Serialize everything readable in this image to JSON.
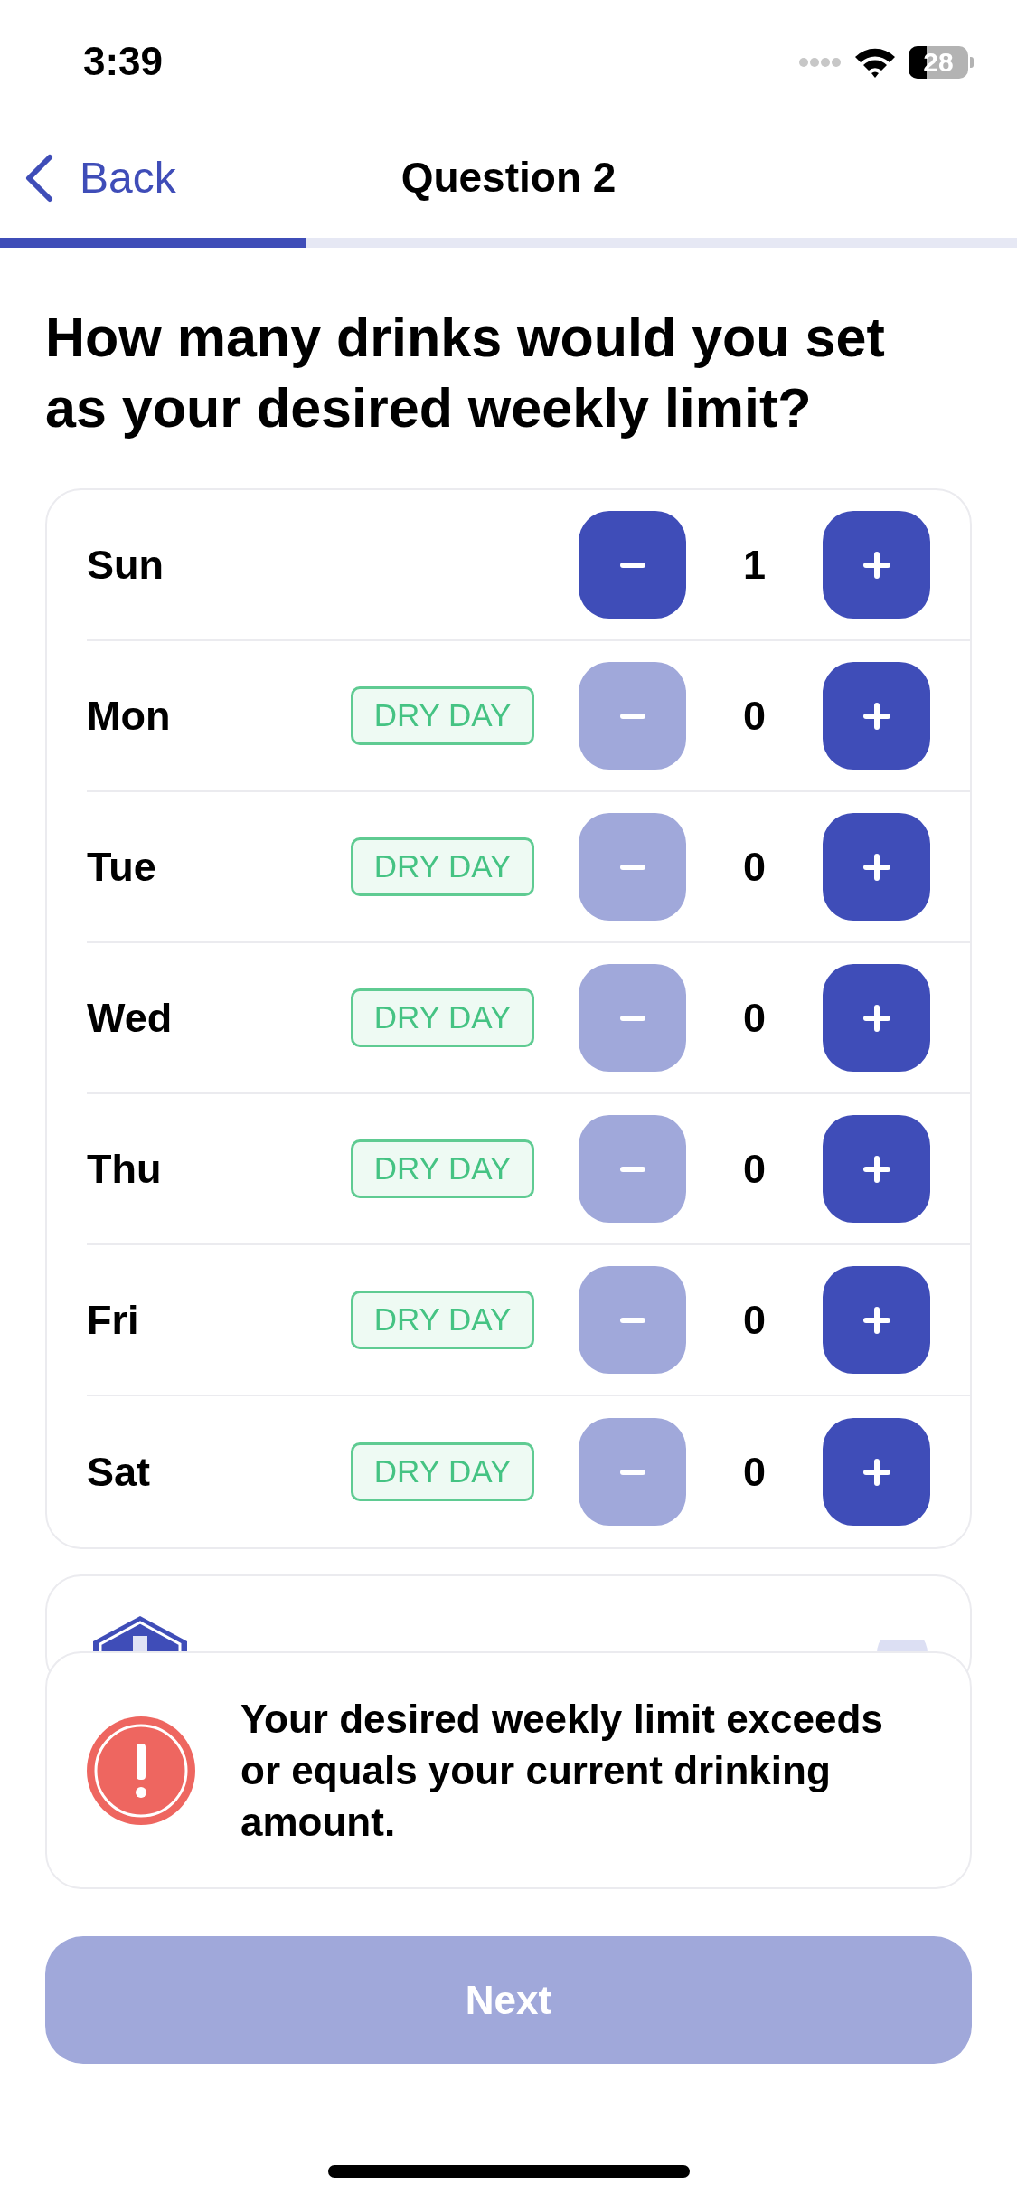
{
  "status_bar": {
    "time": "3:39",
    "battery": "28"
  },
  "nav": {
    "back_label": "Back",
    "title": "Question 2"
  },
  "progress": {
    "level": 0.3
  },
  "question": "How many drinks would you set as your desired weekly limit?",
  "days": [
    {
      "day": "Sun",
      "count": "1",
      "decrement_disabled": false
    },
    {
      "day": "Mon",
      "badge": "DRY DAY",
      "count": "0",
      "decrement_disabled": true
    },
    {
      "day": "Tue",
      "badge": "DRY DAY",
      "count": "0",
      "decrement_disabled": true
    },
    {
      "day": "Wed",
      "badge": "DRY DAY",
      "count": "0",
      "decrement_disabled": true
    },
    {
      "day": "Thu",
      "badge": "DRY DAY",
      "count": "0",
      "decrement_disabled": true
    },
    {
      "day": "Fri",
      "badge": "DRY DAY",
      "count": "0",
      "decrement_disabled": true
    },
    {
      "day": "Sat",
      "badge": "DRY DAY",
      "count": "0",
      "decrement_disabled": true
    }
  ],
  "alert": {
    "message": "Your desired weekly limit exceeds or equals your current drinking amount."
  },
  "next_button": {
    "label": "Next",
    "disabled": true
  }
}
